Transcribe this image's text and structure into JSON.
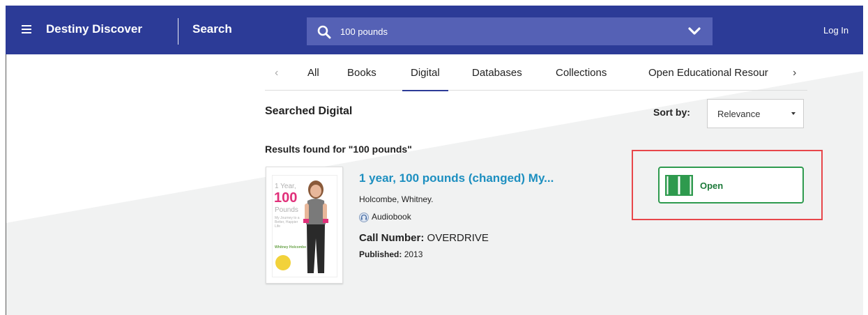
{
  "header": {
    "brand": "Destiny Discover",
    "search_link": "Search",
    "search_query": "100 pounds",
    "login": "Log In",
    "bar_color": "#2c3b97"
  },
  "tabs": {
    "items": [
      {
        "label": "All",
        "active": false
      },
      {
        "label": "Books",
        "active": false
      },
      {
        "label": "Digital",
        "active": true
      },
      {
        "label": "Databases",
        "active": false
      },
      {
        "label": "Collections",
        "active": false
      },
      {
        "label": "Open Educational Resour",
        "active": false
      }
    ],
    "prev_icon": "chevron-left-icon",
    "next_icon": "chevron-right-icon"
  },
  "results": {
    "searched_title": "Searched Digital",
    "sort_label": "Sort by:",
    "sort_value": "Relevance",
    "results_heading": "Results found for \"100 pounds\""
  },
  "item": {
    "title": "1 year, 100 pounds (changed) My...",
    "author": "Holcombe, Whitney.",
    "format": "Audiobook",
    "call_label": "Call Number:",
    "call_value": "OVERDRIVE",
    "published_label": "Published:",
    "published_value": "2013",
    "cover_text": {
      "line1": "1 Year,",
      "line2": "100",
      "line3": "Pounds",
      "line4": "My Journey to a Better, Happier Life",
      "line5": "Whitney Holcombe"
    },
    "open_label": "Open",
    "open_color": "#2e9a4e",
    "highlight_color": "#e8464a"
  }
}
